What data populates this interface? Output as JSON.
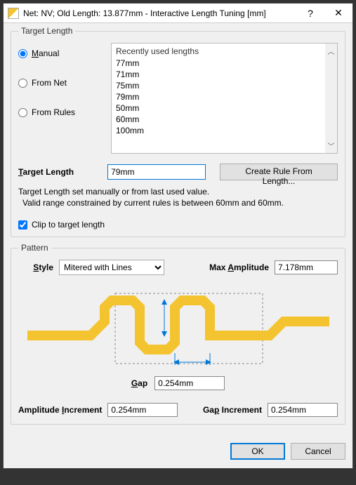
{
  "title": "Net: NV;  Old Length: 13.877mm -  Interactive Length Tuning [mm]",
  "help_icon": "?",
  "close_icon": "✕",
  "target_length": {
    "legend": "Target Length",
    "radios": {
      "manual": "Manual",
      "from_net": "From Net",
      "from_rules": "From Rules"
    },
    "list_header": "Recently used lengths",
    "list_items": [
      "77mm",
      "71mm",
      "75mm",
      "79mm",
      "50mm",
      "60mm",
      "100mm"
    ],
    "label": "Target Length",
    "value": "79mm",
    "create_rule_btn": "Create Rule From Length...",
    "hint1": "Target Length set manually or from last used value.",
    "hint2": "Valid range constrained by current rules is between 60mm and 60mm.",
    "clip_label": "Clip to target length"
  },
  "pattern": {
    "legend": "Pattern",
    "style_label": "Style",
    "style_value": "Mitered with Lines",
    "max_amp_label": "Max Amplitude",
    "max_amp_value": "7.178mm",
    "gap_label": "Gap",
    "gap_value": "0.254mm",
    "amp_inc_label": "Amplitude Increment",
    "amp_inc_value": "0.254mm",
    "gap_inc_label": "Gap Increment",
    "gap_inc_value": "0.254mm"
  },
  "footer": {
    "ok": "OK",
    "cancel": "Cancel"
  }
}
